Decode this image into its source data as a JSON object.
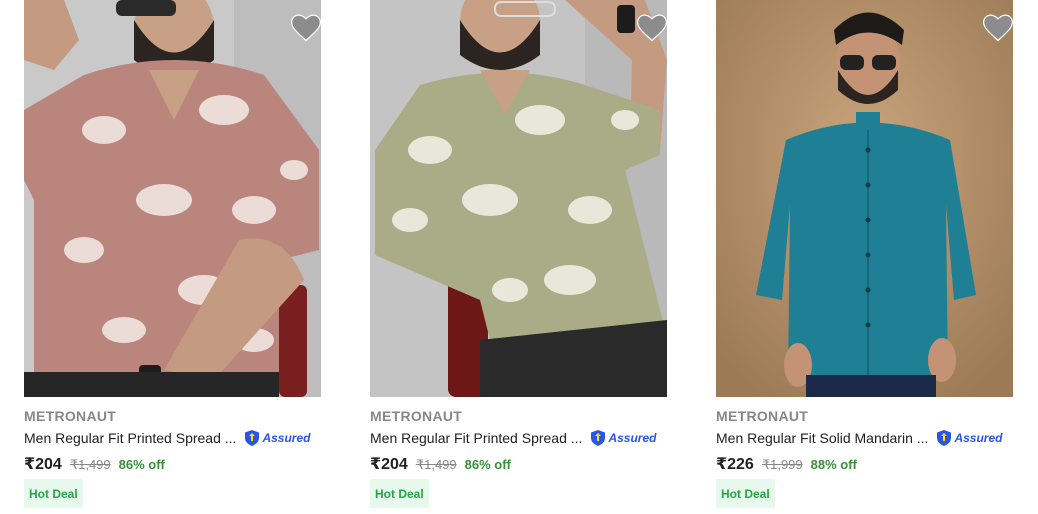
{
  "products": [
    {
      "brand": "METRONAUT",
      "title": "Men Regular Fit Printed Spread ...",
      "assured_label": "Assured",
      "price": "₹204",
      "mrp": "₹1,499",
      "discount": "86% off",
      "badge": "Hot Deal",
      "image": "man-in-pink-floral-shirt",
      "shirt_color": "#b9857c"
    },
    {
      "brand": "METRONAUT",
      "title": "Men Regular Fit Printed Spread ...",
      "assured_label": "Assured",
      "price": "₹204",
      "mrp": "₹1,499",
      "discount": "86% off",
      "badge": "Hot Deal",
      "image": "man-in-sage-floral-shirt",
      "shirt_color": "#a8ad87"
    },
    {
      "brand": "METRONAUT",
      "title": "Men Regular Fit Solid Mandarin ...",
      "assured_label": "Assured",
      "price": "₹226",
      "mrp": "₹1,999",
      "discount": "88% off",
      "badge": "Hot Deal",
      "image": "man-in-teal-mandarin-shirt",
      "shirt_color": "#1f7f94"
    }
  ],
  "icons": {
    "wishlist": "heart-icon",
    "assured": "assured-shield-icon"
  },
  "colors": {
    "discount": "#388e3c",
    "assured": "#2a55e5",
    "badge_bg": "#e7f8ec",
    "badge_text": "#26a541"
  }
}
